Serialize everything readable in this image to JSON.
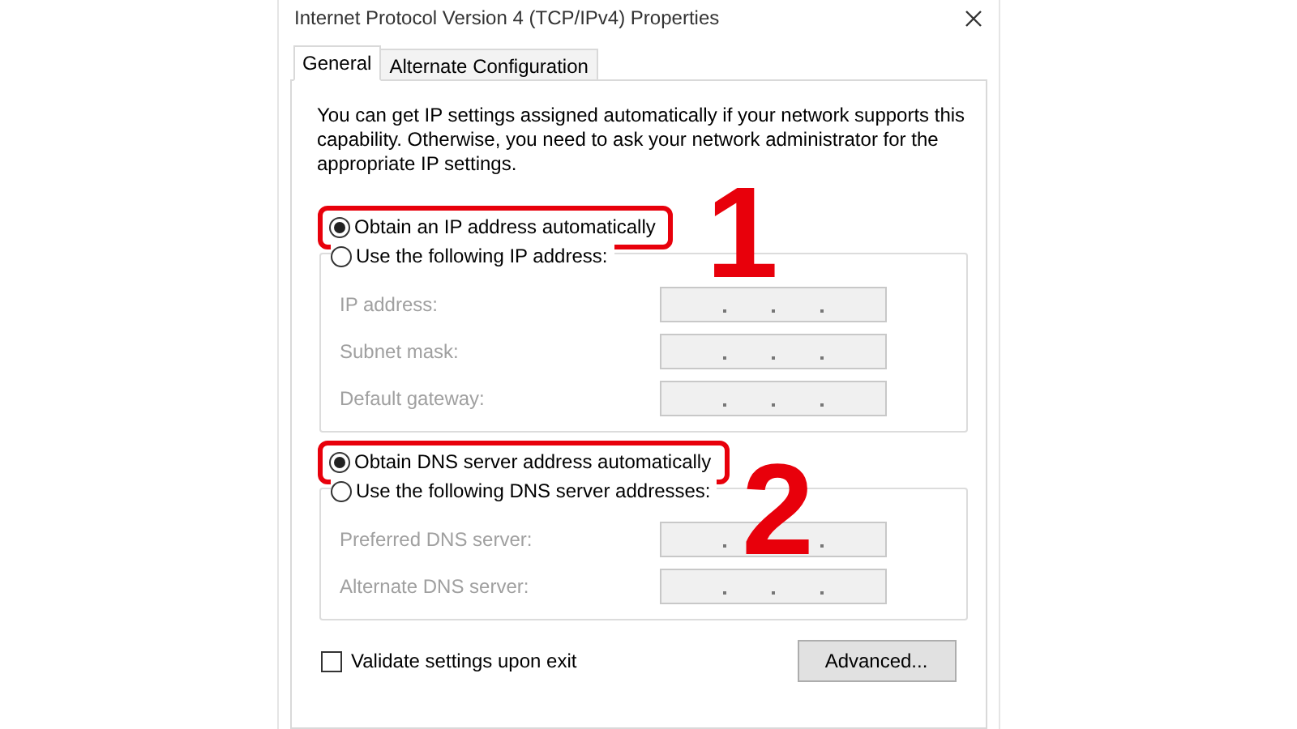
{
  "window": {
    "title": "Internet Protocol Version 4 (TCP/IPv4) Properties"
  },
  "tabs": [
    {
      "label": "General",
      "selected": true
    },
    {
      "label": "Alternate Configuration",
      "selected": false
    }
  ],
  "description": "You can get IP settings assigned automatically if your network supports this capability. Otherwise, you need to ask your network administrator for the appropriate IP settings.",
  "ip_section": {
    "auto_option": {
      "label": "Obtain an IP address automatically",
      "selected": true,
      "annotation": "1"
    },
    "manual_option": {
      "label": "Use the following IP address:",
      "selected": false
    },
    "fields": [
      {
        "label": "IP address:",
        "disabled": true
      },
      {
        "label": "Subnet mask:",
        "disabled": true
      },
      {
        "label": "Default gateway:",
        "disabled": true
      }
    ]
  },
  "dns_section": {
    "auto_option": {
      "label": "Obtain DNS server address automatically",
      "selected": true,
      "annotation": "2"
    },
    "manual_option": {
      "label": "Use the following DNS server addresses:",
      "selected": false
    },
    "fields": [
      {
        "label": "Preferred DNS server:",
        "disabled": true
      },
      {
        "label": "Alternate DNS server:",
        "disabled": true
      }
    ]
  },
  "validate": {
    "label": "Validate settings upon exit",
    "checked": false
  },
  "buttons": [
    "Advanced..."
  ]
}
